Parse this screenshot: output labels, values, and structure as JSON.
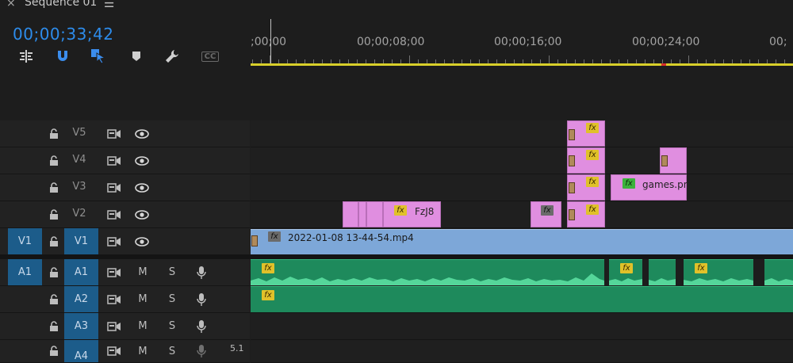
{
  "header": {
    "close_glyph": "×",
    "title": "Sequence 01",
    "menu_glyph": "☰",
    "timecode": "00;00;33;42"
  },
  "toolbar": {
    "tools": [
      "insert-edit-icon",
      "snap-magnet-icon",
      "linked-selection-icon",
      "add-marker-icon",
      "wrench-settings-icon",
      "captions-cc-icon"
    ],
    "cc_label": "CC"
  },
  "ruler": {
    "labels": [
      ";00;00",
      "00;00;08;00",
      "00;00;16;00",
      "00;00;24;00",
      "00;"
    ]
  },
  "tracks": {
    "video": [
      {
        "name": "V5",
        "source": ""
      },
      {
        "name": "V4",
        "source": ""
      },
      {
        "name": "V3",
        "source": ""
      },
      {
        "name": "V2",
        "source": ""
      },
      {
        "name": "V1",
        "source": "V1"
      }
    ],
    "audio": [
      {
        "name": "A1",
        "source": "A1",
        "m": "M",
        "s": "S"
      },
      {
        "name": "A2",
        "source": "",
        "m": "M",
        "s": "S"
      },
      {
        "name": "A3",
        "source": "",
        "m": "M",
        "s": "S"
      },
      {
        "name": "A4",
        "source": "",
        "m": "M",
        "s": "S",
        "extra": "5.1"
      }
    ]
  },
  "clips": {
    "fx_label": "fx",
    "v2_title": "FzJ8",
    "v3_title": "games.pn",
    "v1_title": "2022-01-08 13-44-54.mp4"
  },
  "colors": {
    "accent_blue": "#2d8ceb",
    "video_clip": "#7da7d8",
    "graphic_clip": "#e08ee0",
    "audio_clip": "#1e8a5c",
    "work_area": "#d8cf2a"
  }
}
